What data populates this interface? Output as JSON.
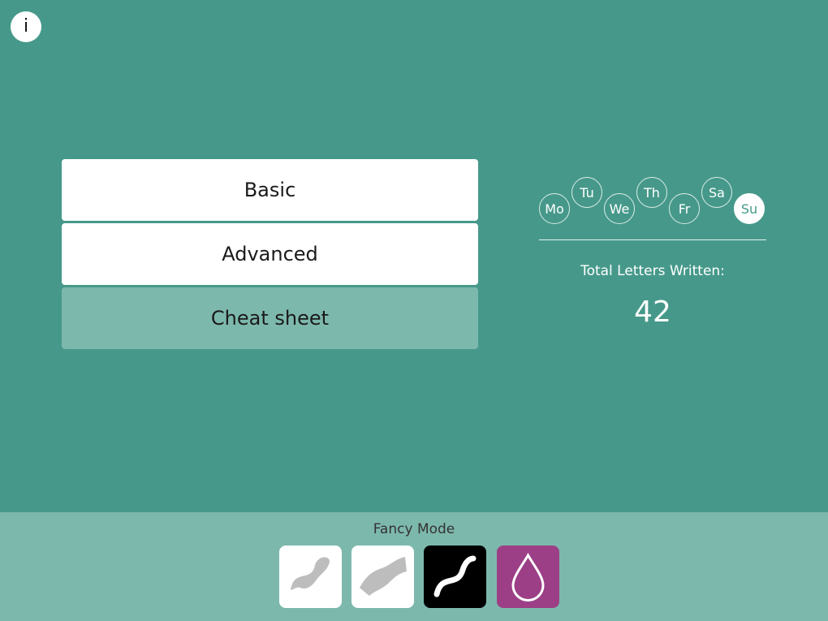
{
  "info_button": {
    "label": "i"
  },
  "menu": {
    "items": [
      {
        "label": "Basic"
      },
      {
        "label": "Advanced"
      },
      {
        "label": "Cheat sheet"
      }
    ]
  },
  "week": {
    "days": [
      "Mo",
      "Tu",
      "We",
      "Th",
      "Fr",
      "Sa",
      "Su"
    ],
    "selected": "Su"
  },
  "stats": {
    "total_label": "Total Letters Written:",
    "total_value": "42"
  },
  "fancy_mode": {
    "label": "Fancy Mode",
    "tools": [
      {
        "icon": "thin-brush-stroke-icon",
        "background": "#ffffff",
        "selected": false
      },
      {
        "icon": "flat-brush-stroke-icon",
        "background": "#ffffff",
        "selected": false
      },
      {
        "icon": "smooth-pen-stroke-icon",
        "background": "#000000",
        "selected": true
      },
      {
        "icon": "ink-drop-icon",
        "background": "#9c3f86",
        "selected": false
      }
    ]
  },
  "colors": {
    "background": "#46998a",
    "light_panel": "#7db8ad",
    "ink_purple": "#9c3f86"
  }
}
